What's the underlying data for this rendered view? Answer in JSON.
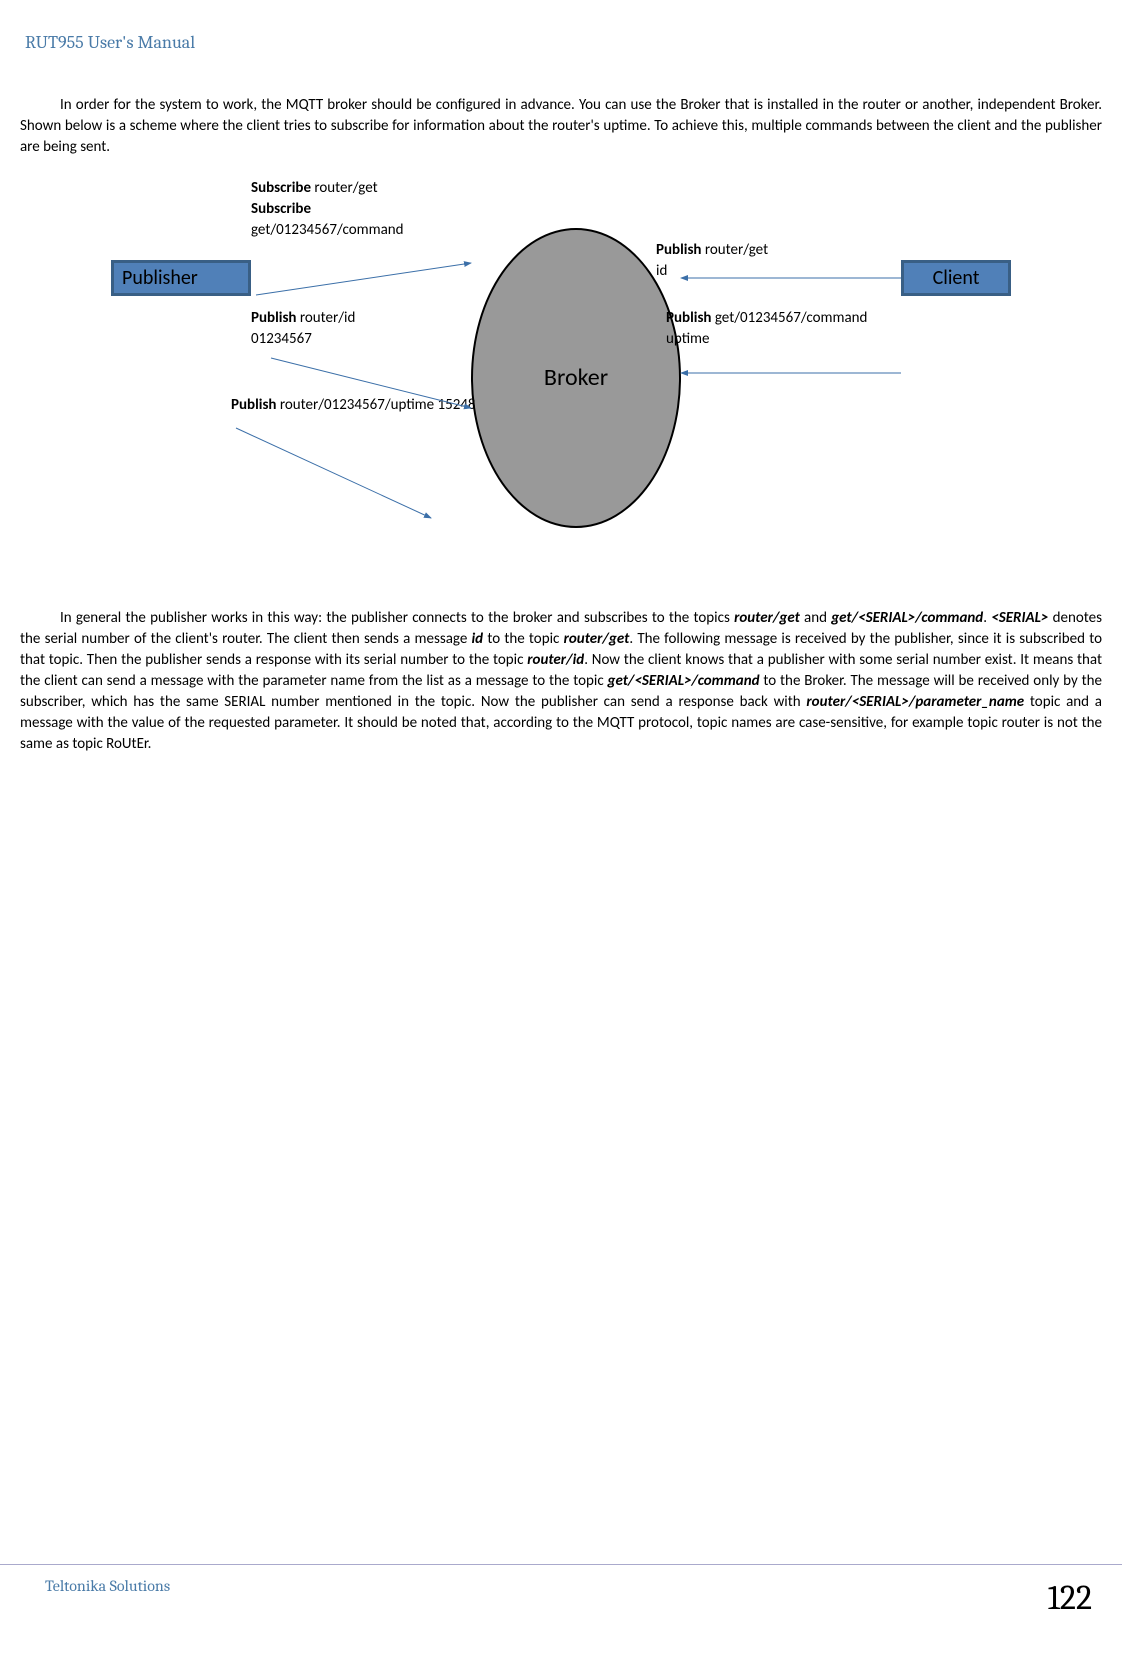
{
  "header": {
    "title": "RUT955 User's Manual"
  },
  "paragraphs": {
    "p1": "In order for the system to work, the MQTT broker should be configured in advance. You can use the Broker that is installed in the router or another, independent Broker. Shown below is a scheme where the client tries to subscribe for information about the router's uptime. To achieve this, multiple commands between the client and the publisher are being sent.",
    "p2_prefix": "In general the publisher works in this way: the publisher connects to the broker and subscribes to the topics ",
    "p2_router_get": "router/get",
    "p2_and": " and ",
    "p2_get_serial": "get/<SERIAL>/command",
    "p2_dot_serial": ". ",
    "p2_serial_label": "<SERIAL>",
    "p2_denotes": " denotes the serial number of the client's router. The client then sends a message ",
    "p2_id": "id",
    "p2_to_topic": " to the topic ",
    "p2_router_get2": "router/get",
    "p2_following": ". The following message is received by the publisher, since it is subscribed to that topic. Then the publisher sends a response with its serial number to the topic ",
    "p2_router_id": "router/id",
    "p2_now_client": ". Now the client knows that a publisher with some serial number exist. It means that the client can send a message with the parameter name from the list as a message to the topic ",
    "p2_get_serial2": "get/<SERIAL>/command",
    "p2_to_broker": " to the Broker. The message will be received only by the subscriber, which has the same SERIAL number mentioned in the topic. Now the publisher can send a response back with ",
    "p2_router_serial_param": "router/<SERIAL>/parameter_name",
    "p2_topic_msg": " topic and a message with the value of the requested parameter. It should be noted that, according to the MQTT protocol, topic names are case-sensitive, for example topic router is not the same as topic RoUtEr."
  },
  "diagram": {
    "publisher": "Publisher",
    "client": "Client",
    "broker": "Broker",
    "subscribe_label": "Subscribe",
    "subscribe1": " router/get",
    "subscribe2_prefix": "Subscribe",
    "subscribe2_text": "get/01234567/command",
    "publish_label": "Publish",
    "pub_router_id": " router/id",
    "pub_router_id_val": "01234567",
    "pub_router_uptime": " router/01234567/uptime 15248",
    "pub_router_get": " router/get",
    "pub_router_get_val": "id",
    "pub_get_cmd": " get/01234567/command",
    "pub_get_cmd_val": "uptime"
  },
  "footer": {
    "left": "Teltonika Solutions",
    "page": "122"
  }
}
